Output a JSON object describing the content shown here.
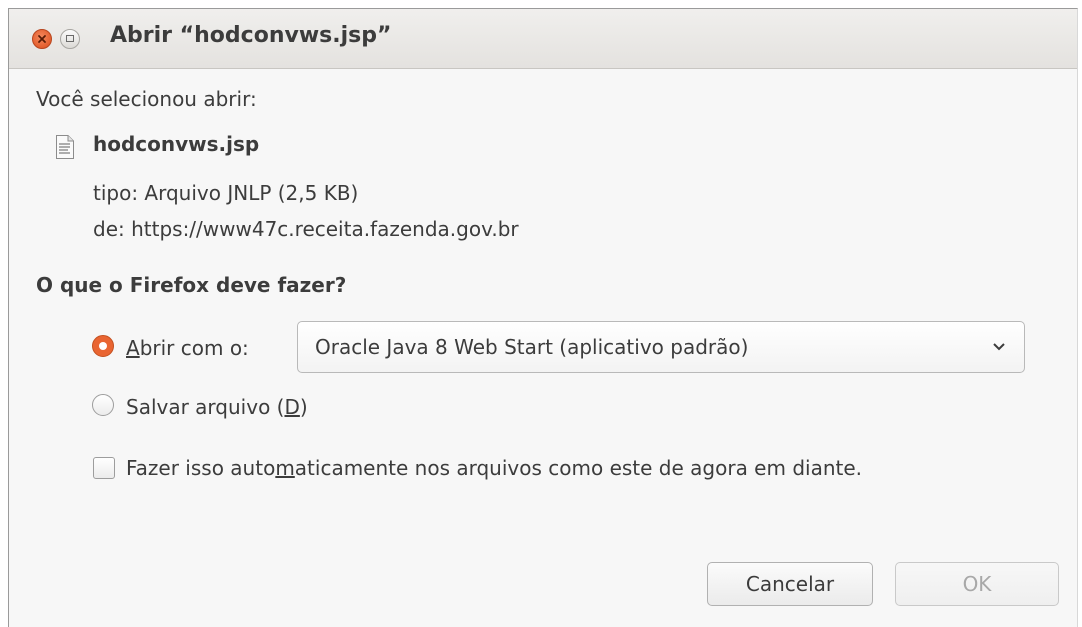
{
  "window": {
    "title": "Abrir “hodconvws.jsp”"
  },
  "intro": "Você selecionou abrir:",
  "file": {
    "name": "hodconvws.jsp",
    "type_line": "tipo: Arquivo JNLP (2,5 KB)",
    "from_line": "de: https://www47c.receita.fazenda.gov.br"
  },
  "question": "O que o Firefox deve fazer?",
  "options": {
    "open_with": {
      "mnemonic": "A",
      "rest": "brir com o:",
      "selected": true
    },
    "app_select": {
      "value": "Oracle Java 8 Web Start (aplicativo padrão)"
    },
    "save_file": {
      "prefix": "Salvar arquivo (",
      "mnemonic": "D",
      "suffix": ")",
      "selected": false
    },
    "auto": {
      "prefix": "Fazer isso auto",
      "mnemonic": "m",
      "suffix": "aticamente nos arquivos como este de agora em diante.",
      "checked": false
    }
  },
  "buttons": {
    "cancel": "Cancelar",
    "ok": "OK"
  },
  "colors": {
    "accent": "#e96532",
    "titlebar": "#e6e4e1",
    "background": "#f7f7f7"
  },
  "icons": {
    "close": "close-icon",
    "maximize": "maximize-icon",
    "file": "text-file-icon",
    "dropdown": "chevron-down-icon"
  }
}
